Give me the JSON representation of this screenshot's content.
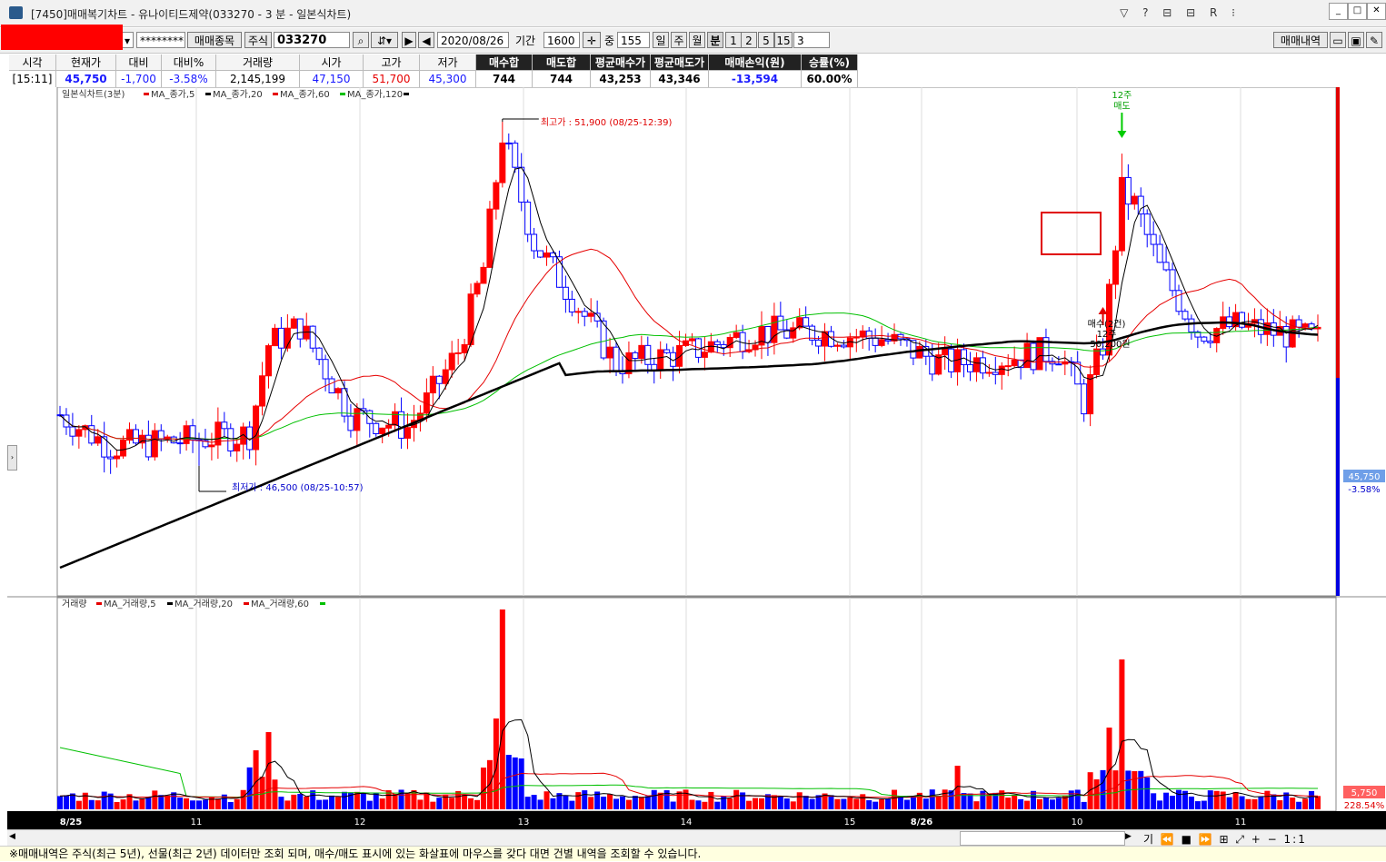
{
  "window": {
    "title": "[7450]매매복기차트 - 유나이티드제약(033270 - 3 분 - 일본식차트)",
    "title_icons": "▽ ? ⊟ ⊟ R ⁝",
    "minimize": "_",
    "maximize": "□",
    "close": "✕"
  },
  "toolbar": {
    "masked_account": "********",
    "trade_stock_btn": "매매종목",
    "market": "주식",
    "code": "033270",
    "date": "2020/08/26",
    "period_label": "기간",
    "period_value": "1600",
    "mid_label": "중",
    "mid_value": "155",
    "day": "일",
    "week": "주",
    "month": "월",
    "minute": "분",
    "n1": "1",
    "n2": "2",
    "n5": "5",
    "n15": "15",
    "interval": "3",
    "trade_history_btn": "매매내역"
  },
  "info": {
    "headers": [
      "시각",
      "현재가",
      "대비",
      "대비%",
      "거래량",
      "시가",
      "고가",
      "저가",
      "매수합",
      "매도합",
      "평균매수가",
      "평균매도가",
      "매매손익(원)",
      "승률(%)"
    ],
    "values": [
      "[15:11]",
      "45,750",
      "-1,700",
      "-3.58%",
      "2,145,199",
      "47,150",
      "51,700",
      "45,300",
      "744",
      "744",
      "43,253",
      "43,346",
      "-13,594",
      "60.00%"
    ]
  },
  "chart": {
    "price_legend": {
      "title": "일본식차트(3분)",
      "ma5": "MA_종가,5",
      "ma20": "MA_종가,20",
      "ma60": "MA_종가,60",
      "ma120": "MA_종가,120"
    },
    "volume_legend": {
      "title": "거래량",
      "ma5": "MA_거래량,5",
      "ma20": "MA_거래량,20",
      "ma60": "MA_거래량,60"
    },
    "high_annot": "최고가 : 51,900 (08/25-12:39)",
    "low_annot": "최저가 : 46,500 (08/25-10:57)",
    "sell_annot": [
      "12주",
      "매도"
    ],
    "buy_annot": [
      "매수(2건)",
      "12주",
      "50,200원"
    ],
    "price_box": "45,750",
    "price_pct": "-3.58%",
    "volume_box": "5,750",
    "volume_pct": "228.54%",
    "x_labels": [
      "8/25",
      "11",
      "12",
      "13",
      "14",
      "15",
      "8/26",
      "10",
      "11"
    ],
    "colors": {
      "up": "#ff0000",
      "down": "#0000ff",
      "ma5": "#000000",
      "ma20": "#e60000",
      "ma60": "#00c000",
      "ma120": "#000000"
    }
  },
  "scroll": {
    "tools": "기 ⏪ ■ ⏩ ⊞ ⤢ + − 1:1"
  },
  "status": {
    "text": "※매매내역은 주식(최근 5년), 선물(최근 2년) 데이터만 조회 되며, 매수/매도 표시에 있는 화살표에 마우스를 갖다 대면 건별 내역을 조회할 수 있습니다."
  }
}
